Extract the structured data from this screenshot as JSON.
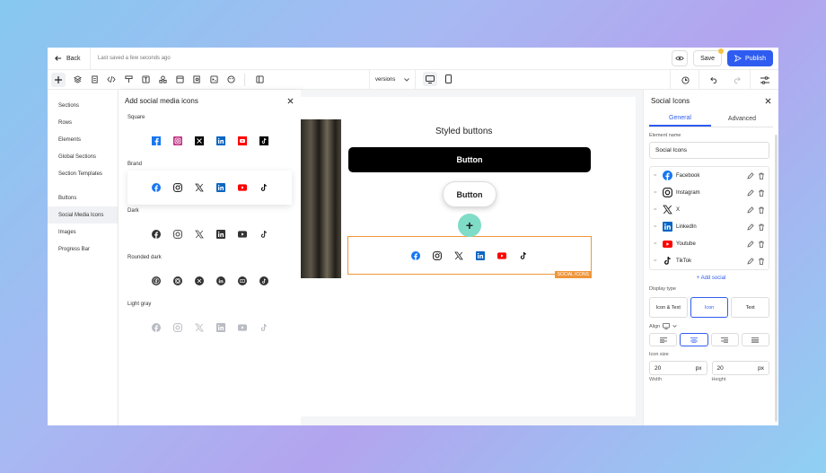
{
  "topbar": {
    "back_label": "Back",
    "saved_text": "Last saved a few seconds ago",
    "save_label": "Save",
    "publish_label": "Publish"
  },
  "toolbar": {
    "versions_label": "versions"
  },
  "leftnav": {
    "items": [
      "Sections",
      "Rows",
      "Elements",
      "Global Sections",
      "Section Templates",
      "Buttons",
      "Social Media Icons",
      "Images",
      "Progress Bar"
    ],
    "active": "Social Media Icons"
  },
  "panel": {
    "title": "Add social media icons",
    "sections": [
      "Square",
      "Brand",
      "Dark",
      "Rounded dark",
      "Light gray"
    ]
  },
  "canvas": {
    "styled_title": "Styled buttons",
    "button_dark": "Button",
    "button_white": "Button",
    "add_symbol": "+",
    "social_tag": "SOCIAL ICONS"
  },
  "rightpanel": {
    "title": "Social Icons",
    "tabs": [
      "General",
      "Advanced"
    ],
    "element_name_label": "Element name",
    "element_name_value": "Social Icons",
    "socials": [
      "Facebook",
      "Instagram",
      "X",
      "LinkedIn",
      "Youtube",
      "TikTok"
    ],
    "add_social": "+ Add social",
    "display_type_label": "Display type",
    "display_types": [
      "Icon & Text",
      "Icon",
      "Text"
    ],
    "display_active": "Icon",
    "align_label": "Align",
    "icon_size_label": "Icon size",
    "width_value": "20",
    "height_value": "20",
    "unit": "px",
    "width_label": "Width",
    "height_label": "Height"
  },
  "colors": {
    "accent": "#2f5cf0",
    "facebook": "#1877f2",
    "instagram": "#c13584",
    "linkedin": "#0a66c2",
    "youtube": "#ff0000",
    "selection": "#f0963a",
    "add_circle": "#7fdcc7"
  }
}
